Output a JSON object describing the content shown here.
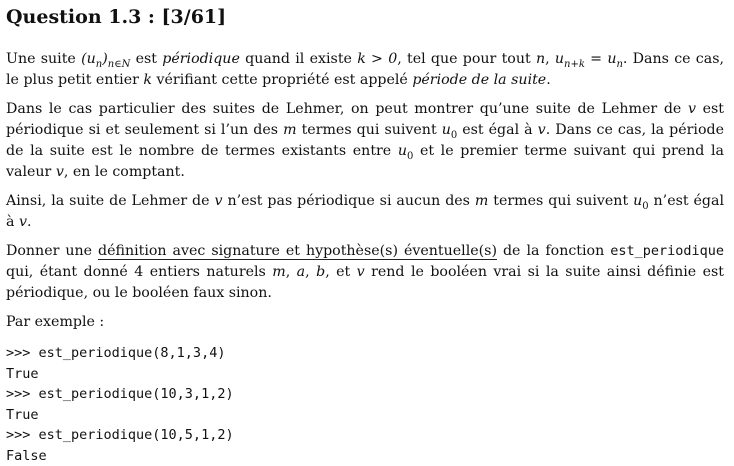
{
  "title": "Question 1.3 : [3/61]",
  "p1": {
    "a": "Une suite ",
    "seq": "(u",
    "seq_close": ")",
    "seq_sub": "n∈N",
    "b": " est ",
    "periodique": "périodique",
    "c": " quand il existe ",
    "cond1": "k > 0",
    "d": ", tel que pour tout ",
    "n": "n",
    "e": ", ",
    "eq_left": "u",
    "eq_left_sub": "n+k",
    "eq_mid": " = ",
    "eq_right": "u",
    "eq_right_sub": "n",
    "f": ". Dans ce cas, le plus petit entier ",
    "k": "k",
    "g": " vérifiant cette propriété est appelé ",
    "periode": "période de la suite",
    "h": "."
  },
  "p2": {
    "a": "Dans le cas particulier des suites de Lehmer, on peut montrer qu’une suite de Lehmer de ",
    "v1": "v",
    "b": " est périodique si et seulement si l’un des ",
    "m": "m",
    "c": " termes qui suivent ",
    "u0": "u",
    "u0_sub": "0",
    "d": " est égal à ",
    "v2": "v",
    "e": ". Dans ce cas, la période de la suite est le nombre de termes existants entre ",
    "u0b": "u",
    "u0b_sub": "0",
    "f": " et le premier terme suivant qui prend la valeur ",
    "v3": "v",
    "g": ", en le comptant."
  },
  "p3": {
    "a": "Ainsi, la suite de Lehmer de ",
    "v1": "v",
    "b": " n’est pas périodique si aucun des ",
    "m": "m",
    "c": " termes qui suivent ",
    "u0": "u",
    "u0_sub": "0",
    "d": " n’est égal à ",
    "v2": "v",
    "e": "."
  },
  "p4": {
    "a": "Donner une ",
    "underlined": "définition avec signature et hypothèse(s) éventuelle(s)",
    "b": " de la fonction ",
    "fname": "est_periodique",
    "c": " qui, étant donné 4 entiers naturels ",
    "m": "m",
    "sep1": ", ",
    "a_var": "a",
    "sep2": ", ",
    "b_var": "b",
    "d": ", et ",
    "v": "v",
    "e": " rend le booléen vrai si la suite ainsi définie est périodique, ou le booléen faux sinon."
  },
  "example_label": "Par exemple :",
  "examples": [
    ">>> est_periodique(8,1,3,4)",
    "True",
    ">>> est_periodique(10,3,1,2)",
    "True",
    ">>> est_periodique(10,5,1,2)",
    "False"
  ]
}
